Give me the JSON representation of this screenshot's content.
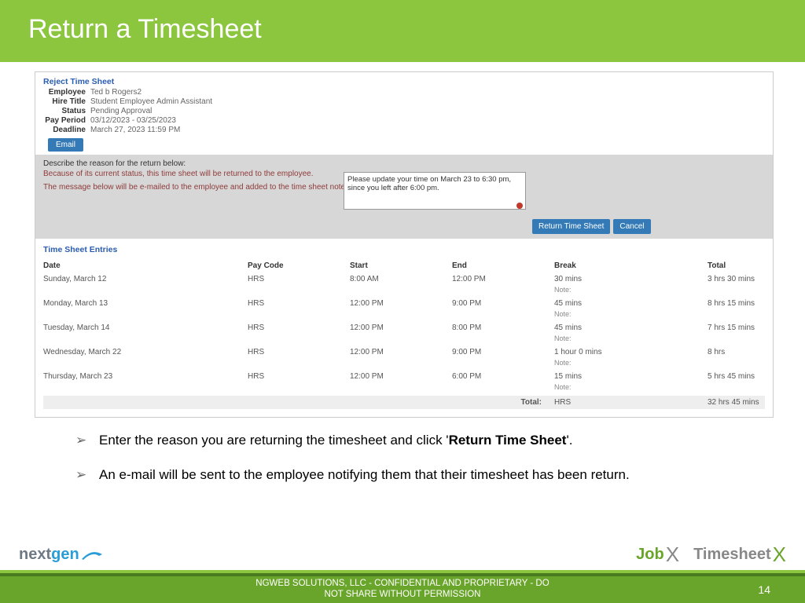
{
  "header": {
    "title": "Return a Timesheet"
  },
  "reject": {
    "title": "Reject Time Sheet",
    "fields": {
      "employee_lbl": "Employee",
      "employee": "Ted b Rogers2",
      "hiretitle_lbl": "Hire Title",
      "hiretitle": "Student Employee Admin Assistant",
      "status_lbl": "Status",
      "status": "Pending Approval",
      "payperiod_lbl": "Pay Period",
      "payperiod": "03/12/2023 - 03/25/2023",
      "deadline_lbl": "Deadline",
      "deadline": "March 27, 2023 11:59 PM"
    },
    "email_btn": "Email"
  },
  "reason": {
    "prompt": "Describe the reason for the return below:",
    "status": "Because of its current status, this time sheet will be returned to the employee.",
    "textarea": "Please update your time on March 23 to 6:30 pm, since you left after 6:00 pm.",
    "note": "The message below will be e-mailed to the employee and added to the time sheet notes.",
    "return_btn": "Return Time Sheet",
    "cancel_btn": "Cancel"
  },
  "entries": {
    "title": "Time Sheet Entries",
    "cols": {
      "date": "Date",
      "paycode": "Pay Code",
      "start": "Start",
      "end": "End",
      "break": "Break",
      "total": "Total"
    },
    "note_lbl": "Note:",
    "rows": [
      {
        "date": "Sunday, March 12",
        "paycode": "HRS",
        "start": "8:00 AM",
        "end": "12:00 PM",
        "break": "30 mins",
        "total": "3 hrs 30 mins"
      },
      {
        "date": "Monday, March 13",
        "paycode": "HRS",
        "start": "12:00 PM",
        "end": "9:00 PM",
        "break": "45 mins",
        "total": "8 hrs 15 mins"
      },
      {
        "date": "Tuesday, March 14",
        "paycode": "HRS",
        "start": "12:00 PM",
        "end": "8:00 PM",
        "break": "45 mins",
        "total": "7 hrs 15 mins"
      },
      {
        "date": "Wednesday, March 22",
        "paycode": "HRS",
        "start": "12:00 PM",
        "end": "9:00 PM",
        "break": "1 hour 0 mins",
        "total": "8 hrs"
      },
      {
        "date": "Thursday, March 23",
        "paycode": "HRS",
        "start": "12:00 PM",
        "end": "6:00 PM",
        "break": "15 mins",
        "total": "5 hrs 45 mins"
      }
    ],
    "total_lbl": "Total:",
    "total_code": "HRS",
    "total_val": "32 hrs 45 mins"
  },
  "bullets": {
    "b1_a": "Enter the reason you are returning the timesheet and click '",
    "b1_b": "Return Time Sheet",
    "b1_c": "'.",
    "b2": "An e-mail will be sent to the employee notifying them that their timesheet has been return."
  },
  "logos": {
    "ng_a": "next",
    "ng_b": "gen",
    "job_a": "Job",
    "job_b": "X",
    "ts_a": "Timesheet",
    "ts_b": "X"
  },
  "footer": {
    "text": "NGWEB SOLUTIONS, LLC - CONFIDENTIAL AND  PROPRIETARY - DO NOT SHARE WITHOUT PERMISSION",
    "page": "14"
  }
}
